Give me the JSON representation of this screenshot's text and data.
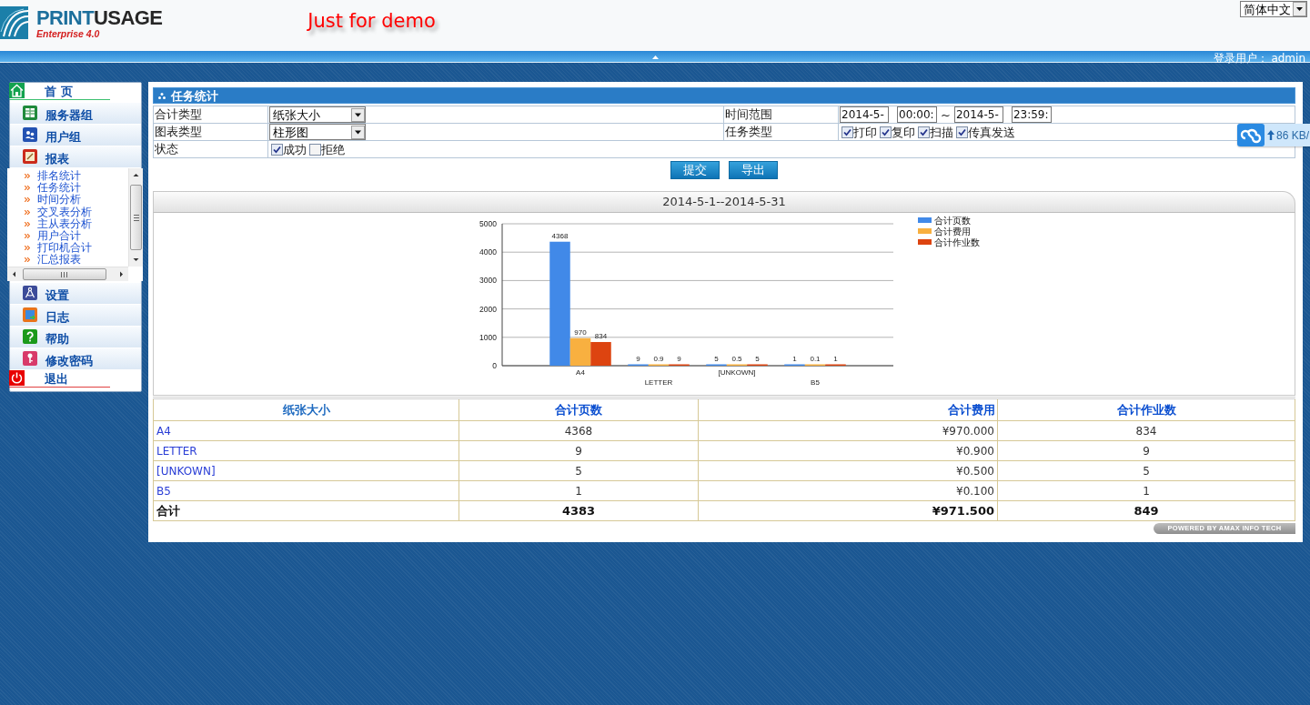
{
  "header": {
    "logo": {
      "wordmark_1": "PRINT",
      "wordmark_2": "USAGE",
      "edition": "Enterprise 4.0"
    },
    "demo_notice": "Just for demo",
    "language_select": {
      "value": "简体中文"
    }
  },
  "top_bar": {
    "login_user": "登录用户： admin"
  },
  "sidebar": {
    "items": [
      {
        "label": "首 页",
        "kind": "home"
      },
      {
        "label": "服务器组",
        "kind": "module"
      },
      {
        "label": "用户组",
        "kind": "module"
      },
      {
        "label": "报表",
        "kind": "module",
        "children": [
          {
            "label": "排名统计"
          },
          {
            "label": "任务统计"
          },
          {
            "label": "时间分析"
          },
          {
            "label": "交叉表分析"
          },
          {
            "label": "主从表分析"
          },
          {
            "label": "用户合计"
          },
          {
            "label": "打印机合计"
          },
          {
            "label": "汇总报表"
          }
        ]
      },
      {
        "label": "设置",
        "kind": "module"
      },
      {
        "label": "日志",
        "kind": "module"
      },
      {
        "label": "帮助",
        "kind": "module"
      },
      {
        "label": "修改密码",
        "kind": "module"
      },
      {
        "label": "退出",
        "kind": "exit"
      }
    ]
  },
  "task_panel": {
    "title": "任务统计",
    "filters": [
      {
        "label": "合计类型",
        "kind": "select",
        "value": "纸张大小"
      },
      {
        "label": "时间范围",
        "kind": "time_range",
        "start_date": "2014-5-",
        "start_time": "00:00:",
        "separator": "~",
        "end_date": "2014-5-",
        "end_time": "23:59:"
      },
      {
        "label": "图表类型",
        "kind": "select",
        "value": "柱形图"
      },
      {
        "label": "任务类型",
        "kind": "checkboxes",
        "options": [
          {
            "label": "打印",
            "checked": true
          },
          {
            "label": "复印",
            "checked": true
          },
          {
            "label": "扫描",
            "checked": true
          },
          {
            "label": "传真发送",
            "checked": true
          }
        ]
      },
      {
        "label": "状态",
        "kind": "checkboxes",
        "options": [
          {
            "label": "成功",
            "checked": true
          },
          {
            "label": "拒绝",
            "checked": false
          }
        ]
      }
    ],
    "buttons": [
      "提交",
      "导出"
    ],
    "chart": {
      "period": "2014-5-1--2014-5-31",
      "chart_data": {
        "type": "bar",
        "categories": [
          "A4",
          "LETTER",
          "[UNKOWN]",
          "B5"
        ],
        "series": [
          {
            "name": "合计页数",
            "color": "#4189e8",
            "values": [
              4368,
              9,
              5,
              1
            ],
            "value_labels": [
              "4368",
              "9",
              "5",
              "1"
            ]
          },
          {
            "name": "合计费用",
            "color": "#f8b040",
            "values": [
              970,
              0.9,
              0.5,
              0.1
            ],
            "value_labels": [
              "970",
              "0.9",
              "0.5",
              "0.1"
            ]
          },
          {
            "name": "合计作业数",
            "color": "#dd4410",
            "values": [
              834,
              9,
              5,
              1
            ],
            "value_labels": [
              "834",
              "9",
              "5",
              "1"
            ]
          }
        ],
        "ylim": [
          0,
          5000
        ],
        "yticks": [
          0,
          1000,
          2000,
          3000,
          4000,
          5000
        ],
        "grid": true,
        "legend": "right",
        "data_labels": true
      }
    },
    "summary_table": {
      "columns": [
        "纸张大小",
        "合计页数",
        "合计费用",
        "合计作业数"
      ],
      "rows": [
        [
          "A4",
          "4368",
          "¥970.000",
          "834"
        ],
        [
          "LETTER",
          "9",
          "¥0.900",
          "9"
        ],
        [
          "[UNKOWN]",
          "5",
          "¥0.500",
          "5"
        ],
        [
          "B5",
          "1",
          "¥0.100",
          "1"
        ]
      ],
      "total": [
        "合计",
        "4383",
        "¥971.500",
        "849"
      ]
    },
    "powered_by": "POWERED BY AMAX INFO TECH"
  },
  "upload_widget": {
    "speed": "86 KB/"
  }
}
